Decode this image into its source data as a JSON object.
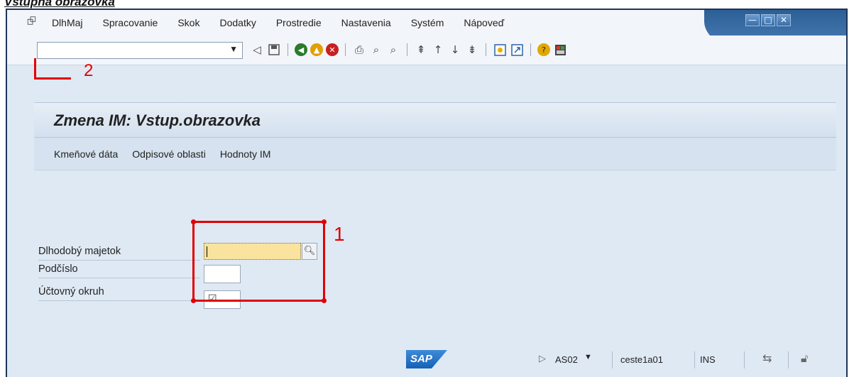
{
  "caption": "Vstupná obrazovka",
  "window": {
    "buttons": {
      "minimize": "—",
      "maximize": "□",
      "close": "✕"
    }
  },
  "menu": {
    "items": [
      "DlhMaj",
      "Spracovanie",
      "Skok",
      "Dodatky",
      "Prostredie",
      "Nastavenia",
      "Systém",
      "Nápoveď"
    ]
  },
  "toolbar": {
    "command_field_value": "",
    "dropdown_icon": "chevron-down-icon"
  },
  "annotations": {
    "command_field_marker": "2",
    "input_group_marker": "1",
    "marker_color": "#e00000"
  },
  "screen": {
    "title": "Zmena IM: Vstup.obrazovka"
  },
  "app_toolbar": {
    "buttons": [
      "Kmeňové dáta",
      "Odpisové oblasti",
      "Hodnoty IM"
    ]
  },
  "form": {
    "fields": [
      {
        "label": "Dlhodobý majetok",
        "value": ""
      },
      {
        "label": "Podčíslo",
        "value": ""
      },
      {
        "label": "Účtovný okruh",
        "value": "☑"
      }
    ]
  },
  "status": {
    "logo": "SAP",
    "system": "AS02",
    "client": "ceste1a01",
    "mode": "INS"
  },
  "colors": {
    "window_bg": "#dfe9f4",
    "input_highlight": "#f9e39e",
    "title_strip": "#2c5f95"
  }
}
